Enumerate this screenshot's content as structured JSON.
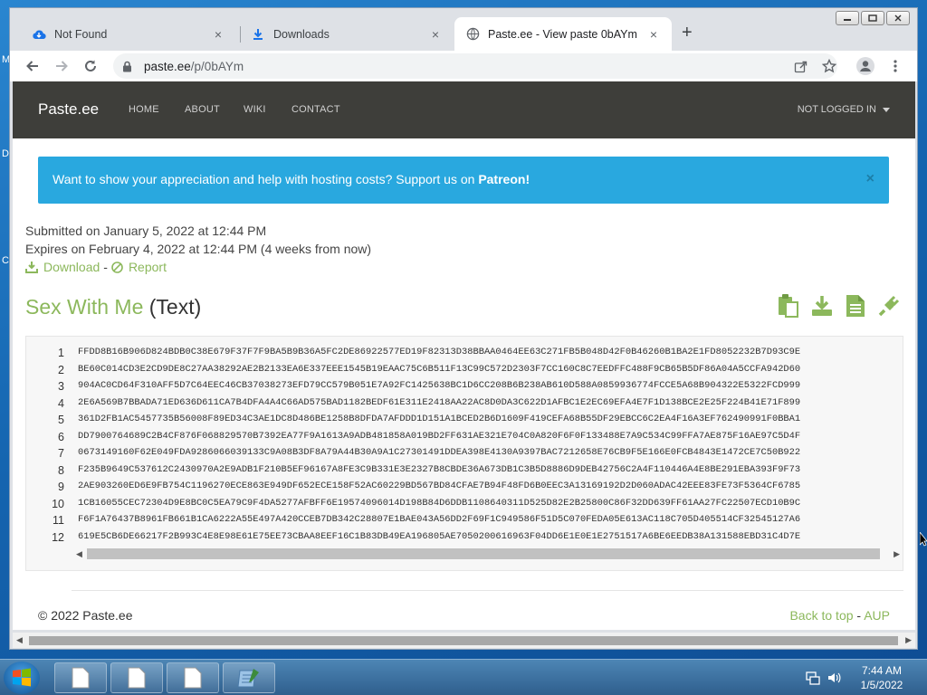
{
  "desktop": {
    "edge_letters": [
      "M",
      "D",
      "C"
    ]
  },
  "browser": {
    "tabs": [
      {
        "label": "Not Found",
        "icon": "cloud-icon"
      },
      {
        "label": "Downloads",
        "icon": "download-icon"
      },
      {
        "label": "Paste.ee - View paste 0bAYm",
        "icon": "globe-icon",
        "active": true
      }
    ],
    "new_tab": "+",
    "close_glyph": "×",
    "address": {
      "host": "paste.ee",
      "path": "/p/0bAYm"
    }
  },
  "site": {
    "brand": "Paste.ee",
    "nav": [
      "HOME",
      "ABOUT",
      "WIKI",
      "CONTACT"
    ],
    "user_menu": "NOT LOGGED IN"
  },
  "alert": {
    "text": "Want to show your appreciation and help with hosting costs? Support us on ",
    "link": "Patreon",
    "suffix": "!",
    "close": "×"
  },
  "meta": {
    "submitted": "Submitted on January 5, 2022 at 12:44 PM",
    "expires": "Expires on February 4, 2022 at 12:44 PM (4 weeks from now)",
    "download": "Download",
    "separator": "-",
    "report": "Report"
  },
  "paste": {
    "title": "Sex With Me",
    "type": "(Text)",
    "lines": [
      {
        "n": "1",
        "text": "FFDD8B16B906D824BDB0C38E679F37F7F9BA5B9B36A5FC2DE86922577ED19F82313D38BBAA0464EE63C271FB5B048D42F0B46260B1BA2E1FD8052232B7D93C9E"
      },
      {
        "n": "2",
        "text": "BE60C014CD3E2CD9DE8C27AA38292AE2B2133EA6E337EEE1545B19EAAC75C6B511F13C99C572D2303F7CC160C8C7EEDFFC488F9CB65B5DF86A04A5CCFA942D60"
      },
      {
        "n": "3",
        "text": "904AC0CD64F310AFF5D7C64EEC46CB37038273EFD79CC579B051E7A92FC1425638BC1D6CC208B6B238AB610D588A0859936774FCCE5A68B904322E5322FCD999"
      },
      {
        "n": "4",
        "text": "2E6A569B7BBADA71ED636D611CA7B4DFA4A4C66AD575BAD1182BEDF61E311E2418AA22AC8D0DA3C622D1AFBC1E2EC69EFA4E7F1D138BCE2E25F224B41E71F899"
      },
      {
        "n": "5",
        "text": "361D2FB1AC5457735B56008F89ED34C3AE1DC8D486BE1258B8DFDA7AFDDD1D151A1BCED2B6D1609F419CEFA68B55DF29EBCC6C2EA4F16A3EF762490991F0BBA1"
      },
      {
        "n": "6",
        "text": "DD7900764689C2B4CF876F068829570B7392EA77F9A1613A9ADB481858A019BD2FF631AE321E704C0A820F6F0F133488E7A9C534C99FFA7AE875F16AE97C5D4F"
      },
      {
        "n": "7",
        "text": "0673149160F62E049FDA9286066039133C9A08B3DF8A79A44B30A9A1C27301491DDEA398E4130A9397BAC7212658E76CB9F5E166E0FCB4843E1472CE7C50B922"
      },
      {
        "n": "8",
        "text": "F235B9649C537612C2430970A2E9ADB1F210B5EF96167A8FE3C9B331E3E2327B8CBDE36A673DB1C3B5D8886D9DEB42756C2A4F110446A4E8BE291EBA393F9F73"
      },
      {
        "n": "9",
        "text": "2AE903260ED6E9FB754C1196270ECE863E949DF652ECE158F52AC60229BD567BD84CFAE7B94F48FD6B0EEC3A13169192D2D060ADAC42EEE83FE73F5364CF6785"
      },
      {
        "n": "10",
        "text": "1CB16055CEC72304D9E8BC0C5EA79C9F4DA5277AFBFF6E19574096014D198B84D6DDB1108640311D525D82E2B25800C86F32DD639FF61AA27FC22507ECD10B9C"
      },
      {
        "n": "11",
        "text": "F6F1A76437B8961FB661B1CA6222A55E497A420CCEB7DB342C28807E1BAE043A56DD2F69F1C949586F51D5C070FEDA05E613AC118C705D405514CF32545127A6"
      },
      {
        "n": "12",
        "text": "619E5CB6DE66217F2B993C4E8E98E61E75EE73CBAA8EEF16C1B83DB49EA196805AE7050200616963F04DD6E1E0E1E2751517A6BE6EEDB38A131588EBD31C4D7E"
      }
    ]
  },
  "footer": {
    "copyright": "© 2022 Paste.ee",
    "back_to_top": "Back to top",
    "separator": "-",
    "aup": "AUP"
  },
  "taskbar": {
    "time": "7:44 AM",
    "date": "1/5/2022"
  },
  "colors": {
    "nav_bg": "#3e3e3a",
    "alert_bg": "#29a8df",
    "accent_green": "#8cb85c"
  }
}
